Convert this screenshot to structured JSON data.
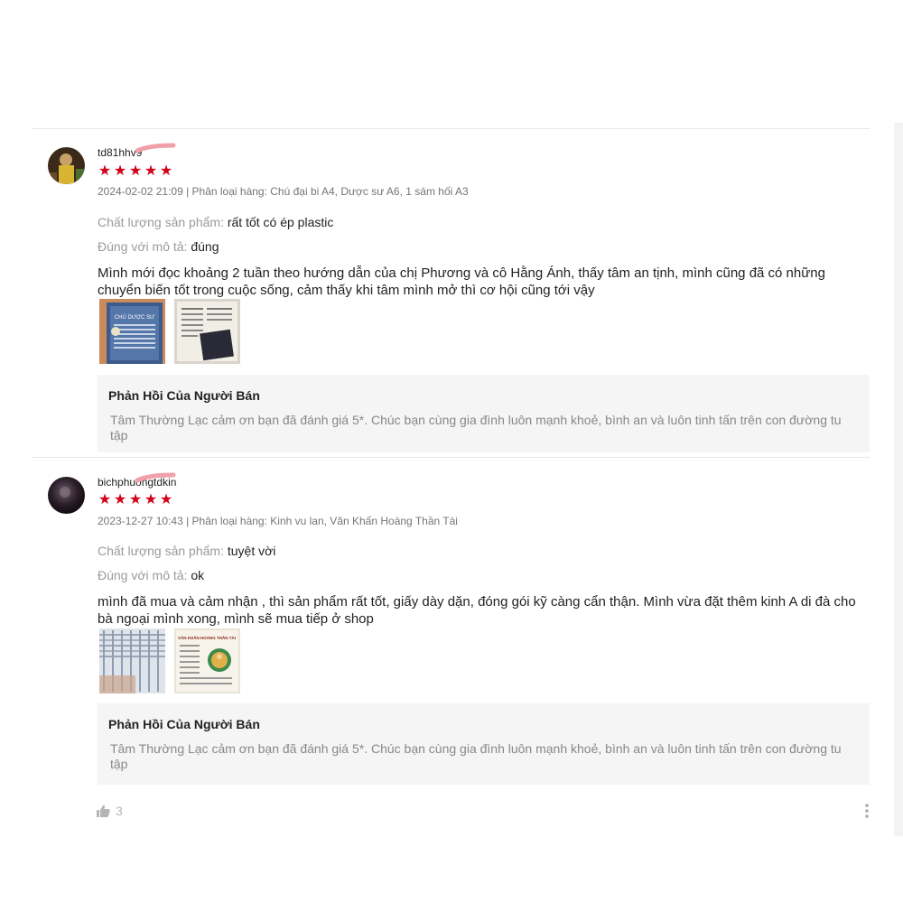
{
  "colors": {
    "star": "#d0021b",
    "muted": "#9a9a9a",
    "reply_bg": "#f5f5f5"
  },
  "reviews": [
    {
      "username": "td81hhv9",
      "rating": 5,
      "meta": "2024-02-02 21:09 | Phân loại hàng: Chú đại bi A4, Dược sư A6, 1 sám hối A3",
      "quality_label": "Chất lượng sản phẩm:",
      "quality_value": "rất tốt có ép plastic",
      "match_label": "Đúng với mô tả:",
      "match_value": "đúng",
      "comment": "Mình mới đọc khoảng 2 tuần theo hướng dẫn của chị Phương và cô Hằng Ánh, thấy tâm an tịnh, mình cũng đã có những chuyển biến tốt trong cuộc sống, cảm thấy khi tâm mình mở thì cơ hội cũng tới vậy",
      "images": [
        {
          "caption": "CHÚ DƯỢC SƯ"
        },
        {
          "caption": ""
        }
      ],
      "reply": {
        "title": "Phản Hồi Của Người Bán",
        "text": "Tâm Thường Lạc cảm ơn bạn đã đánh giá 5*. Chúc bạn cùng gia đình luôn mạnh khoẻ, bình an và luôn tinh tấn trên con đường tu tập"
      }
    },
    {
      "username": "bichphuongtdkin",
      "rating": 5,
      "meta": "2023-12-27 10:43 | Phân loại hàng: Kinh vu lan, Văn Khấn Hoàng Thần Tài",
      "quality_label": "Chất lượng sản phẩm:",
      "quality_value": "tuyệt vời",
      "match_label": "Đúng với mô tả:",
      "match_value": "ok",
      "comment": "mình đã mua và cảm nhận , thì sản phẩm rất tốt, giấy dày dặn, đóng gói kỹ càng cẩn thận. Mình vừa đặt thêm kinh A di đà cho bà ngoại mình xong, mình sẽ mua tiếp ở shop",
      "images": [
        {
          "caption": ""
        },
        {
          "caption": "VĂN KHẤN HOÀNG THẦN TÀI"
        }
      ],
      "reply": {
        "title": "Phản Hồi Của Người Bán",
        "text": "Tâm Thường Lạc cảm ơn bạn đã đánh giá 5*. Chúc bạn cùng gia đình luôn mạnh khoẻ, bình an và luôn tinh tấn trên con đường tu tập"
      }
    }
  ],
  "footer": {
    "like_count": "3",
    "like_icon": "thumbs-up-icon",
    "more_icon": "more-vertical-icon"
  }
}
